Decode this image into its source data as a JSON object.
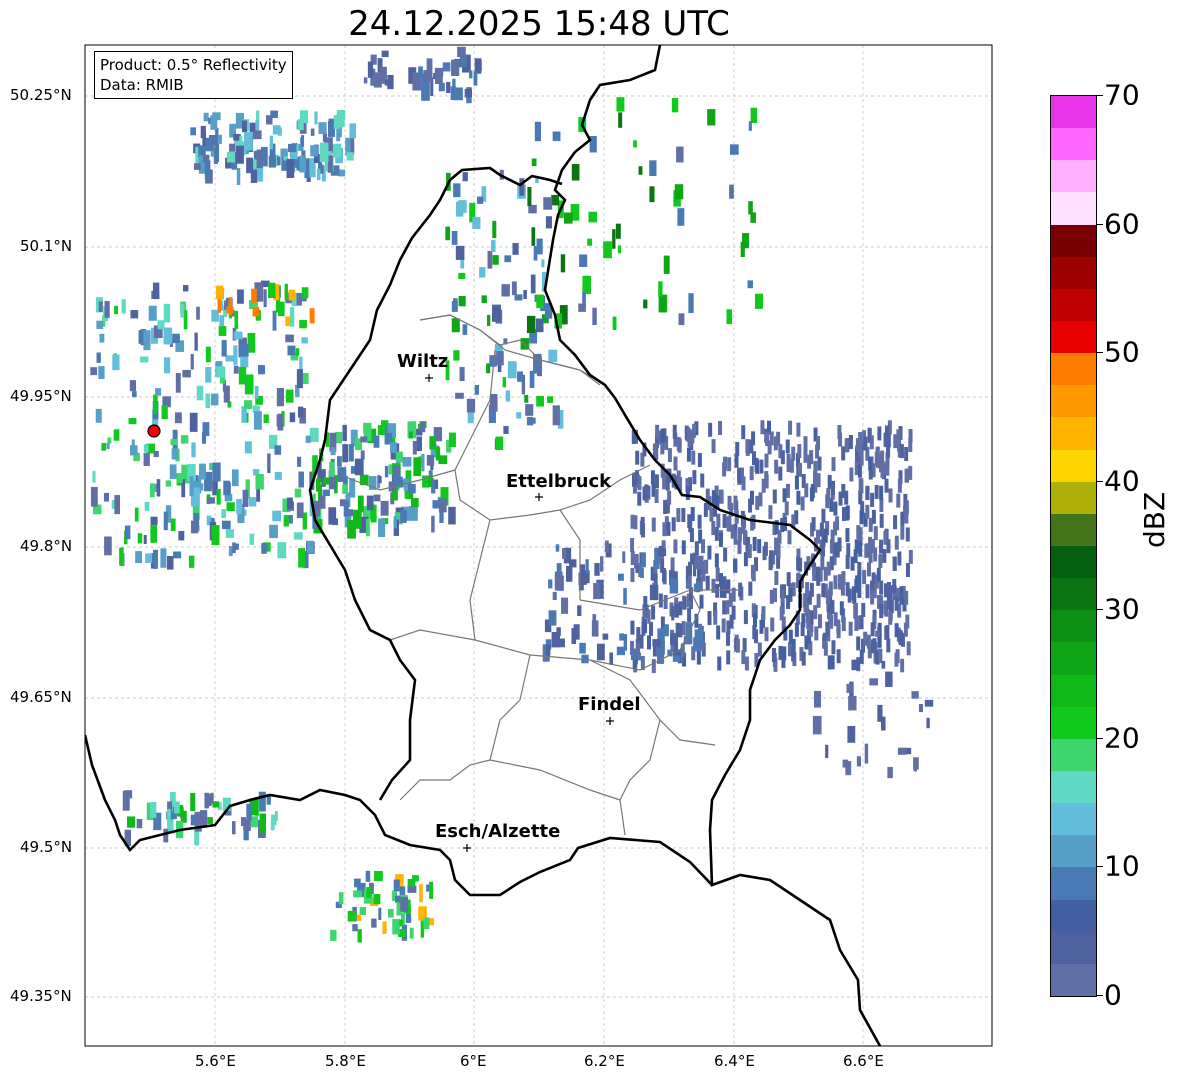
{
  "title": "24.12.2025 15:48 UTC",
  "info": {
    "product": "Product: 0.5° Reflectivity",
    "data": "Data: RMIB"
  },
  "lon_ticks": [
    "5.6°E",
    "5.8°E",
    "6°E",
    "6.2°E",
    "6.4°E",
    "6.6°E"
  ],
  "lat_ticks": [
    "50.25°N",
    "50.1°N",
    "49.95°N",
    "49.8°N",
    "49.65°N",
    "49.5°N",
    "49.35°N"
  ],
  "cities": [
    {
      "name": "Wiltz"
    },
    {
      "name": "Ettelbruck"
    },
    {
      "name": "Findel"
    },
    {
      "name": "Esch/Alzette"
    }
  ],
  "colorbar": {
    "label": "dBZ",
    "ticks": [
      "0",
      "10",
      "20",
      "30",
      "40",
      "50",
      "60",
      "70"
    ],
    "colors": [
      "#6070a6",
      "#4f62a0",
      "#4360a2",
      "#4a7ab4",
      "#589fc8",
      "#62bedb",
      "#5fd8c4",
      "#3fd56e",
      "#11c91c",
      "#10b818",
      "#0ea516",
      "#0d8e15",
      "#0a7512",
      "#055f10",
      "#44751a",
      "#afb10a",
      "#ffd600",
      "#ffb500",
      "#ff9800",
      "#ff7c00",
      "#e60000",
      "#c00000",
      "#9c0000",
      "#780000",
      "#ffe0ff",
      "#ffb0ff",
      "#ff66ff",
      "#e836e8"
    ]
  },
  "radar_site_color": "#ff0000"
}
